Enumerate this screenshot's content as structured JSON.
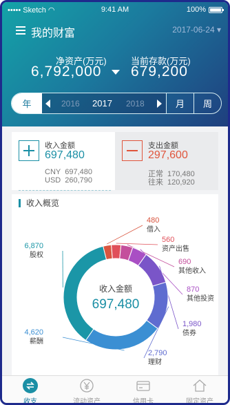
{
  "status_bar": {
    "carrier": "Sketch",
    "time": "9:41 AM",
    "battery": "100%"
  },
  "header": {
    "title": "我的财富",
    "date": "2017-06-24"
  },
  "summary": {
    "net_assets_label": "净资产(万元)",
    "net_assets_value": "6,792,000",
    "deposit_label": "当前存款(万元)",
    "deposit_value": "679,200"
  },
  "period_tabs": {
    "year_label": "年",
    "years": [
      "2016",
      "2017",
      "2018"
    ],
    "current_year": "2017",
    "month_label": "月",
    "week_label": "周"
  },
  "income_card": {
    "label": "收入金额",
    "value": "697,480",
    "rows": [
      {
        "currency": "CNY",
        "amount": "697,480"
      },
      {
        "currency": "USD",
        "amount": "260,790"
      }
    ]
  },
  "expense_card": {
    "label": "支出金额",
    "value": "297,600",
    "rows": [
      {
        "currency": "正常",
        "amount": "170,480"
      },
      {
        "currency": "往来",
        "amount": "120,920"
      }
    ]
  },
  "overview": {
    "title": "收入概览",
    "center_label": "收入金额",
    "center_value": "697,480"
  },
  "chart_data": {
    "type": "pie",
    "title": "收入概览",
    "categories": [
      "借入",
      "资产出售",
      "其他收入",
      "其他投资",
      "债券",
      "理财",
      "薪酬",
      "股权"
    ],
    "values": [
      480,
      560,
      690,
      870,
      1980,
      2790,
      4620,
      6870
    ],
    "colors": [
      "#d9553f",
      "#e0505a",
      "#c44f9c",
      "#a94fc4",
      "#7a55c8",
      "#5f6cd0",
      "#3b8fd3",
      "#1b96a7"
    ]
  },
  "bottom_nav": [
    {
      "label": "收支",
      "icon": "income-expense-icon",
      "active": true
    },
    {
      "label": "流动资产",
      "icon": "yen-coin-icon",
      "active": false
    },
    {
      "label": "信用卡",
      "icon": "credit-card-icon",
      "active": false
    },
    {
      "label": "固定资产",
      "icon": "house-icon",
      "active": false
    }
  ],
  "colors": {
    "accent": "#1b8fa5",
    "expense": "#e0553c",
    "header_start": "#14a3a8",
    "header_end": "#1f3f7e"
  }
}
